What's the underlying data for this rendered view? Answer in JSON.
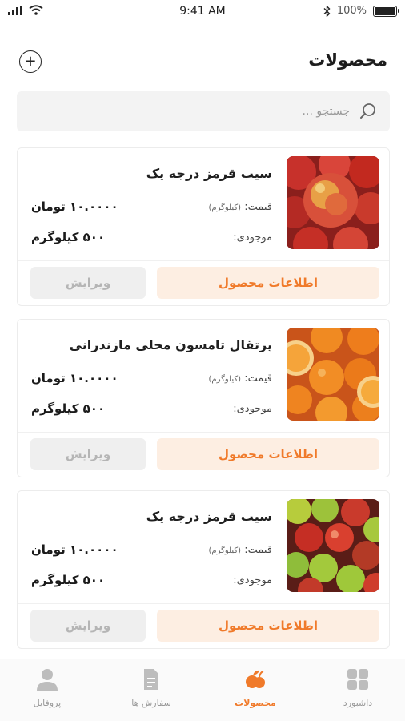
{
  "status_bar": {
    "time": "9:41 AM",
    "battery": "100%"
  },
  "header": {
    "title": "محصولات",
    "add_icon": "plus-circle-icon"
  },
  "search": {
    "placeholder": "جستجو ...",
    "icon": "search-icon"
  },
  "products": [
    {
      "name": "سیب قرمز درجه یک",
      "price_label": "قیمت:",
      "price_unit": "(کیلوگرم)",
      "price_value": "۱۰.۰۰۰۰ تومان",
      "stock_label": "موجودی:",
      "stock_value": "۵۰۰ کیلوگرم",
      "info_button": "اطلاعات محصول",
      "edit_button": "ویرایش",
      "image": "red-apples-image"
    },
    {
      "name": "پرتقال تامسون محلی مازندرانی",
      "price_label": "قیمت:",
      "price_unit": "(کیلوگرم)",
      "price_value": "۱۰.۰۰۰۰ تومان",
      "stock_label": "موجودی:",
      "stock_value": "۵۰۰ کیلوگرم",
      "info_button": "اطلاعات محصول",
      "edit_button": "ویرایش",
      "image": "oranges-image"
    },
    {
      "name": "سیب قرمز درجه یک",
      "price_label": "قیمت:",
      "price_unit": "(کیلوگرم)",
      "price_value": "۱۰.۰۰۰۰ تومان",
      "stock_label": "موجودی:",
      "stock_value": "۵۰۰ کیلوگرم",
      "info_button": "اطلاعات محصول",
      "edit_button": "ویرایش",
      "image": "mixed-apples-image"
    }
  ],
  "bottom_nav": {
    "items": [
      {
        "label": "داشبورد",
        "icon": "dashboard-grid-icon",
        "active": false
      },
      {
        "label": "محصولات",
        "icon": "fruit-icon",
        "active": true
      },
      {
        "label": "سفارش ها",
        "icon": "document-icon",
        "active": false
      },
      {
        "label": "پروفایل",
        "icon": "user-icon",
        "active": false
      }
    ]
  },
  "colors": {
    "accent": "#f07a2a",
    "accent_light": "#fdeee2",
    "muted_button": "#efefef"
  }
}
